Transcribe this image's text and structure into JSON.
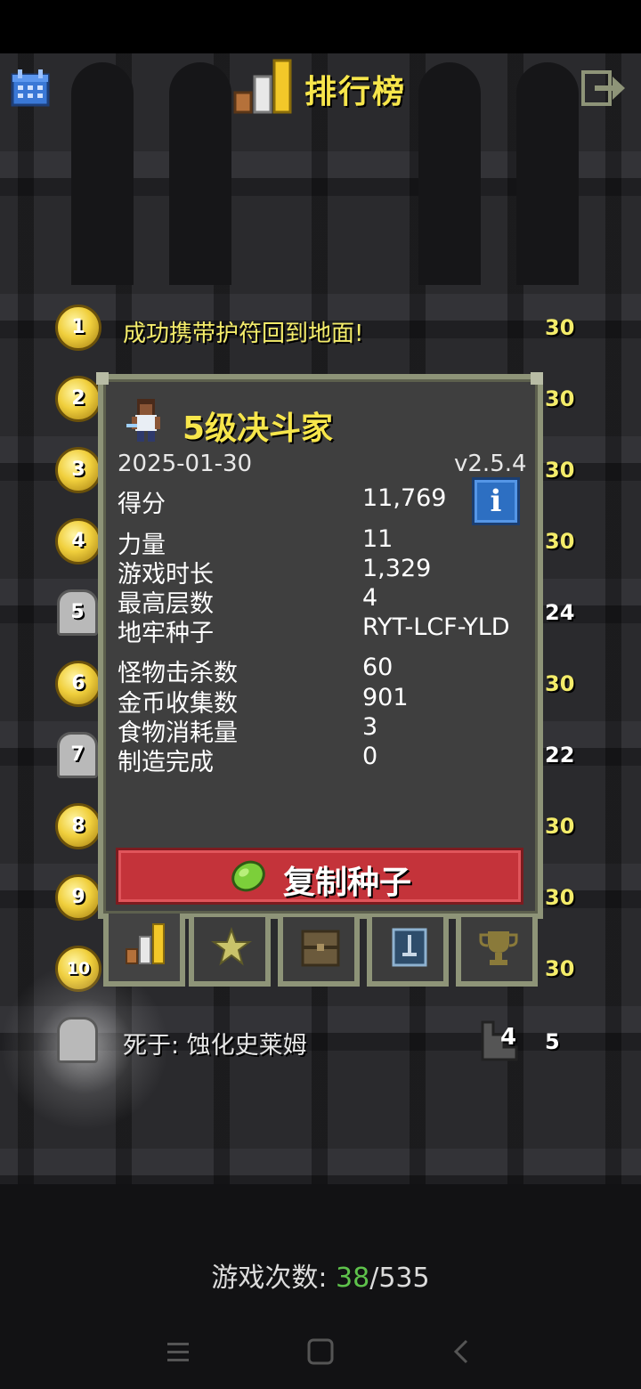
{
  "header": {
    "title": "排行榜",
    "calendar_icon": "calendar-icon",
    "exit_icon": "exit-icon",
    "logo_icon": "rankings-bars-icon"
  },
  "rankings": [
    {
      "rank": "1",
      "text": "成功携带护符回到地面!",
      "score": "30",
      "type": "medal"
    },
    {
      "rank": "2",
      "text": "",
      "score": "30",
      "type": "medal"
    },
    {
      "rank": "3",
      "text": "",
      "score": "30",
      "type": "medal"
    },
    {
      "rank": "4",
      "text": "",
      "score": "30",
      "type": "medal"
    },
    {
      "rank": "5",
      "text": "",
      "score": "24",
      "type": "tomb"
    },
    {
      "rank": "6",
      "text": "",
      "score": "30",
      "type": "medal"
    },
    {
      "rank": "7",
      "text": "",
      "score": "22",
      "type": "tomb"
    },
    {
      "rank": "8",
      "text": "",
      "score": "30",
      "type": "medal"
    },
    {
      "rank": "9",
      "text": "",
      "score": "30",
      "type": "medal"
    },
    {
      "rank": "10",
      "text": "",
      "score": "30",
      "type": "medal"
    }
  ],
  "current_run": {
    "death_text": "死于: 蚀化史莱姆",
    "depth": "4",
    "score": "5"
  },
  "dialog": {
    "hero_title": "5级决斗家",
    "date": "2025-01-30",
    "version": "v2.5.4",
    "info_label": "i",
    "stats": [
      {
        "label": "得分",
        "value": "11,769"
      },
      {
        "label": "力量",
        "value": "11"
      },
      {
        "label": "游戏时长",
        "value": "1,329"
      },
      {
        "label": "最高层数",
        "value": "4"
      },
      {
        "label": "地牢种子",
        "value": "RYT-LCF-YLD"
      },
      {
        "label": "怪物击杀数",
        "value": "60"
      },
      {
        "label": "金币收集数",
        "value": "901"
      },
      {
        "label": "食物消耗量",
        "value": "3"
      },
      {
        "label": "制造完成",
        "value": "0"
      }
    ],
    "copy_seed_label": "复制种子",
    "tabs": [
      "stats-icon",
      "star-badge-icon",
      "inventory-chest-icon",
      "sword-card-icon",
      "trophy-icon"
    ]
  },
  "footer": {
    "games_label": "游戏次数: ",
    "games_played": "38",
    "separator": "/",
    "games_total": "535"
  },
  "colors": {
    "accent_yellow": "#f7e64b",
    "button_red": "#c4333a",
    "info_blue": "#2d6fc2",
    "count_green": "#5ec24b"
  }
}
